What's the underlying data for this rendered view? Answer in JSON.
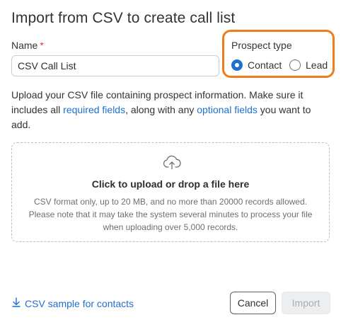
{
  "dialog": {
    "title": "Import from CSV to create call list"
  },
  "name_field": {
    "label": "Name",
    "required_mark": "*",
    "value": "CSV Call List"
  },
  "prospect_type": {
    "label": "Prospect type",
    "options": [
      {
        "label": "Contact",
        "checked": true
      },
      {
        "label": "Lead",
        "checked": false
      }
    ],
    "highlight_color": "#f07d1a"
  },
  "description": {
    "part1": "Upload your CSV file containing prospect information. Make sure it includes all ",
    "required_link": "required fields",
    "part2": ", along with any ",
    "optional_link": "optional fields",
    "part3": " you want to add."
  },
  "dropzone": {
    "icon": "cloud-upload-icon",
    "title": "Click to upload or drop a file here",
    "hint": "CSV format only, up to 20 MB, and no more than 20000 records allowed. Please note that it may take the system several minutes to process your file when uploading over 5,000 records."
  },
  "footer": {
    "sample_link": "CSV sample for contacts",
    "sample_icon": "download-icon",
    "cancel_label": "Cancel",
    "import_label": "Import"
  },
  "colors": {
    "accent": "#1f6fd1",
    "required": "#d93a3a"
  }
}
